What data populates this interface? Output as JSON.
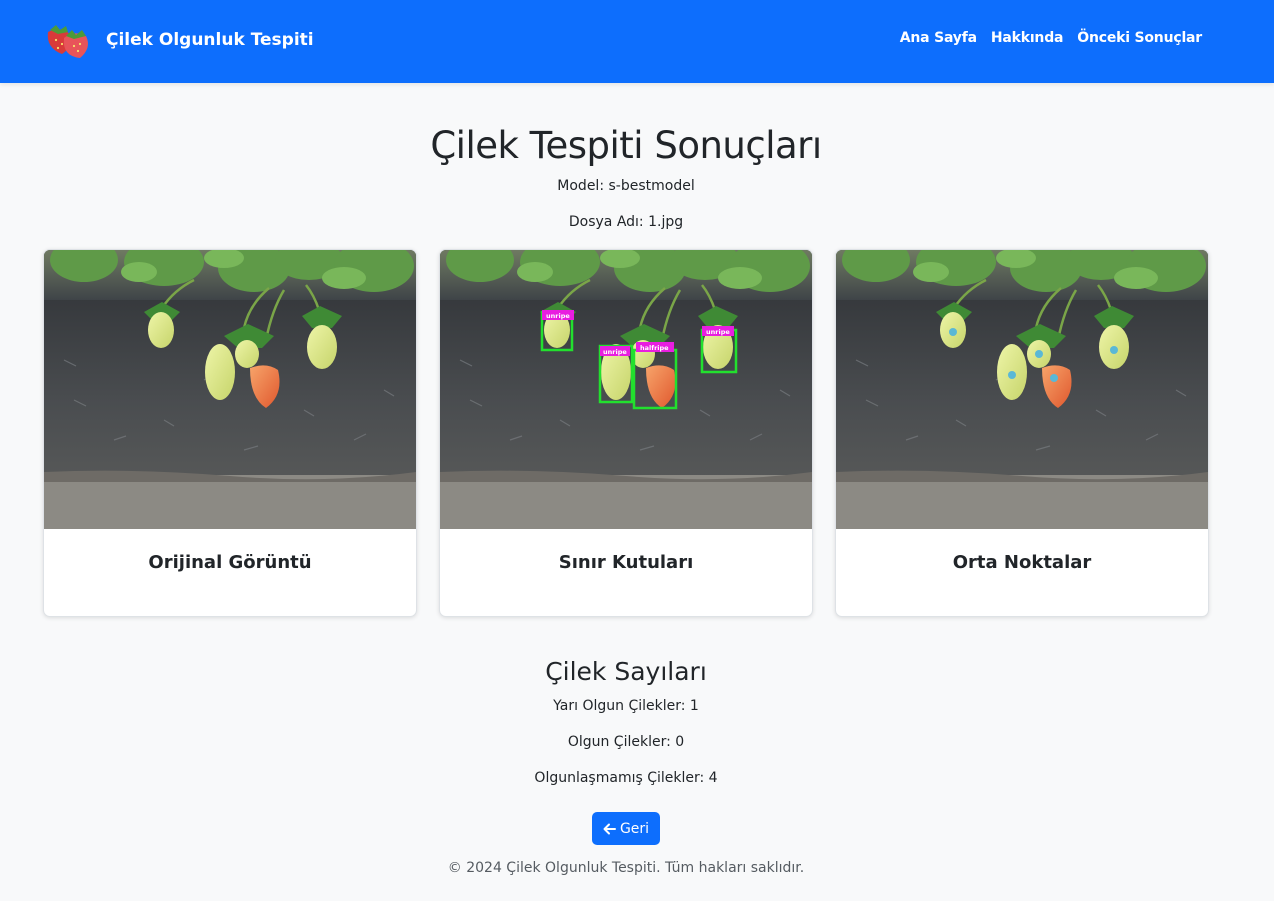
{
  "navbar": {
    "brand_title": "Çilek Olgunluk Tespiti",
    "links": [
      "Ana Sayfa",
      "Hakkında",
      "Önceki Sonuçlar"
    ],
    "color": "#0d6efd"
  },
  "results": {
    "title": "Çilek Tespiti Sonuçları",
    "model_line": "Model: s-bestmodel",
    "file_line": "Dosya Adı: 1.jpg"
  },
  "cards": [
    {
      "title": "Orijinal Görüntü",
      "icon": "strawberry-photo"
    },
    {
      "title": "Sınır Kutuları",
      "icon": "strawberry-photo-bounding-boxes",
      "box_labels": [
        "unripe",
        "unripe",
        "halfripe",
        "unripe"
      ]
    },
    {
      "title": "Orta Noktalar",
      "icon": "strawberry-photo-center-points"
    }
  ],
  "counts": {
    "title": "Çilek Sayıları",
    "half_ripe": "Yarı Olgun Çilekler: 1",
    "ripe": "Olgun Çilekler: 0",
    "unripe": "Olgunlaşmamış Çilekler: 4"
  },
  "back_button": {
    "label": "Geri",
    "icon": "arrow-left-icon"
  },
  "footer": {
    "text": "© 2024 Çilek Olgunluk Tespiti. Tüm hakları saklıdır."
  }
}
